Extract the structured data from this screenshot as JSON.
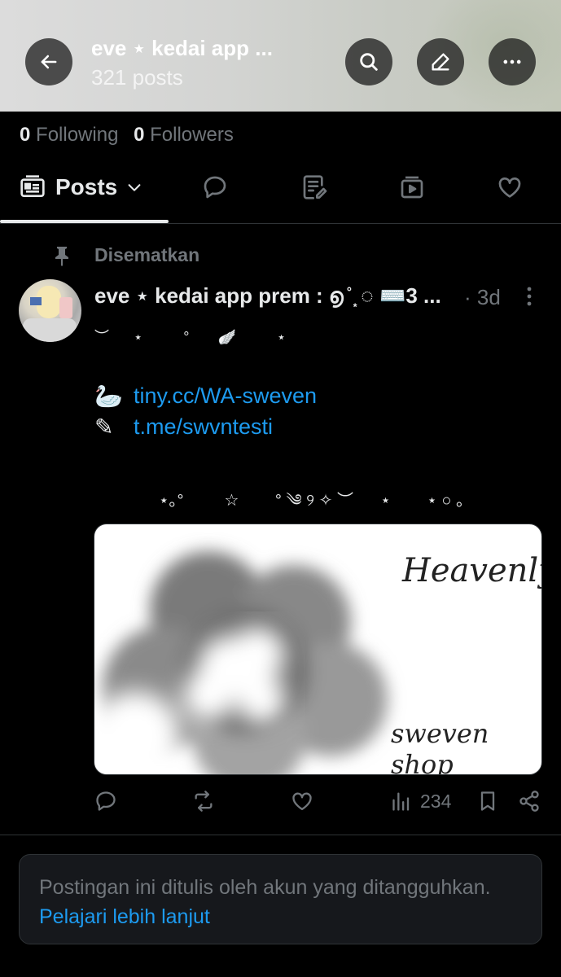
{
  "header": {
    "title": "eve ⋆ kedai app ...",
    "subtitle": "321 posts"
  },
  "profile_stats": {
    "following_count": "0",
    "following_label": "Following",
    "followers_count": "0",
    "followers_label": "Followers"
  },
  "tabs": {
    "posts_label": "Posts",
    "active": "posts"
  },
  "pinned_label": "Disematkan",
  "post": {
    "author": "eve ⋆ kedai app prem : ൭ ̊ ͙ ◌ ⌨️3 ...",
    "time": "· 3d",
    "deco_line1": "︶      ⋆          °       🪽          ⋆",
    "link1_emoji": "🦢",
    "link1": "tiny.cc/WA-sweven",
    "link2_emoji": "✎",
    "link2": "t.me/swvntesti",
    "deco_line2": "⋆｡°         ☆        ° ༄ ୨ ✧ ︶      ⋆        ⋆ ○ 。",
    "media_text1": "Heavenly",
    "media_text2": "sweven shop",
    "views": "234"
  },
  "notice": {
    "text": "Postingan ini ditulis oleh akun yang ditangguhkan.",
    "link": "Pelajari lebih lanjut"
  },
  "colors": {
    "background": "#000000",
    "link": "#1d9bf0",
    "muted": "#71767b",
    "text": "#e7e9ea"
  }
}
